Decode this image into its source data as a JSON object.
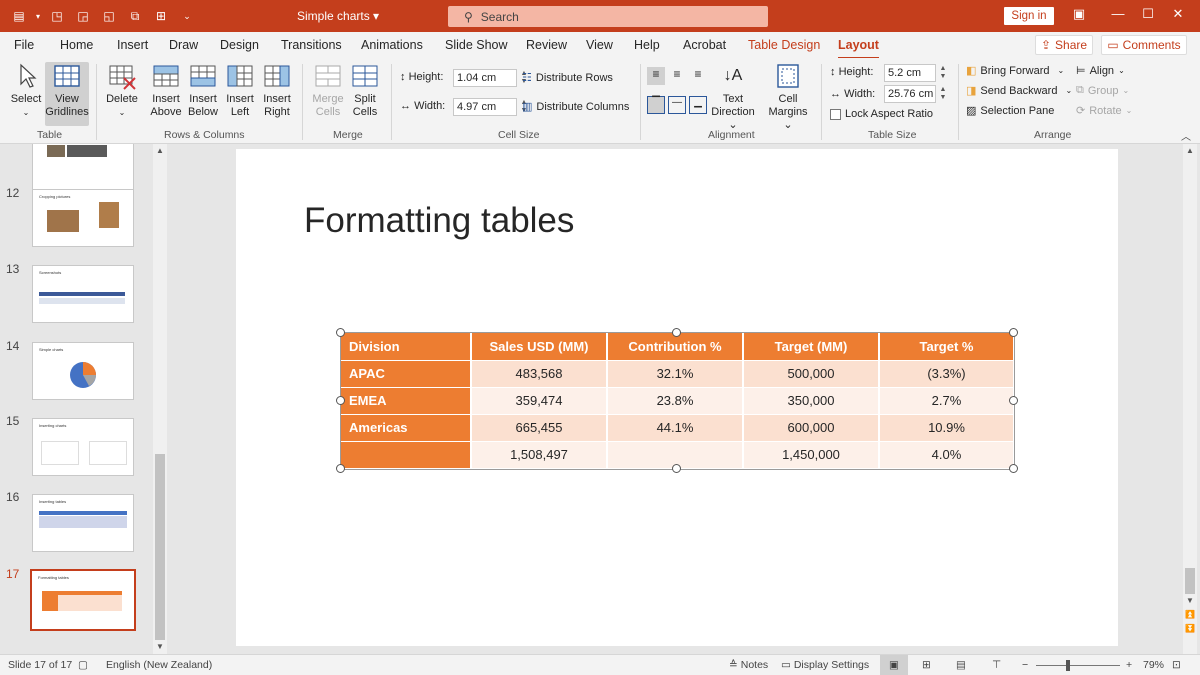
{
  "titlebar": {
    "doc_title": "Simple charts",
    "search_placeholder": "Search",
    "signin": "Sign in"
  },
  "tabs": [
    "File",
    "Home",
    "Insert",
    "Draw",
    "Design",
    "Transitions",
    "Animations",
    "Slide Show",
    "Review",
    "View",
    "Help",
    "Acrobat",
    "Table Design",
    "Layout"
  ],
  "share": "Share",
  "comments": "Comments",
  "ribbon": {
    "table_group": {
      "label": "Table",
      "select": "Select",
      "view": "View",
      "gridlines": "Gridlines"
    },
    "rows_cols_group": {
      "label": "Rows & Columns",
      "delete": "Delete",
      "insert_above_1": "Insert",
      "insert_above_2": "Above",
      "insert_below_1": "Insert",
      "insert_below_2": "Below",
      "insert_left_1": "Insert",
      "insert_left_2": "Left",
      "insert_right_1": "Insert",
      "insert_right_2": "Right"
    },
    "merge_group": {
      "label": "Merge",
      "merge_1": "Merge",
      "merge_2": "Cells",
      "split_1": "Split",
      "split_2": "Cells"
    },
    "cell_size_group": {
      "label": "Cell Size",
      "height_label": "Height:",
      "height_value": "1.04 cm",
      "width_label": "Width:",
      "width_value": "4.97 cm",
      "distribute_rows": "Distribute Rows",
      "distribute_columns": "Distribute Columns"
    },
    "alignment_group": {
      "label": "Alignment",
      "text_direction_1": "Text",
      "text_direction_2": "Direction",
      "cell_margins_1": "Cell",
      "cell_margins_2": "Margins"
    },
    "table_size_group": {
      "label": "Table Size",
      "height_label": "Height:",
      "height_value": "5.2 cm",
      "width_label": "Width:",
      "width_value": "25.76 cm",
      "lock_aspect": "Lock Aspect Ratio"
    },
    "arrange_group": {
      "label": "Arrange",
      "bring_forward": "Bring Forward",
      "send_backward": "Send Backward",
      "selection_pane": "Selection Pane",
      "align": "Align",
      "group": "Group",
      "rotate": "Rotate"
    }
  },
  "slides": [
    {
      "num": "12",
      "title": "Cropping pictures"
    },
    {
      "num": "13",
      "title": "Screenshots"
    },
    {
      "num": "14",
      "title": "Simple charts"
    },
    {
      "num": "15",
      "title": "Inserting charts"
    },
    {
      "num": "16",
      "title": "Inserting tables"
    },
    {
      "num": "17",
      "title": "Formatting tables"
    }
  ],
  "slide": {
    "title": "Formatting tables",
    "table": {
      "headers": [
        "Division",
        "Sales USD (MM)",
        "Contribution %",
        "Target (MM)",
        "Target %"
      ],
      "rows": [
        [
          "APAC",
          "483,568",
          "32.1%",
          "500,000",
          "(3.3%)"
        ],
        [
          "EMEA",
          "359,474",
          "23.8%",
          "350,000",
          "2.7%"
        ],
        [
          "Americas",
          "665,455",
          "44.1%",
          "600,000",
          "10.9%"
        ],
        [
          "",
          "1,508,497",
          "",
          "1,450,000",
          "4.0%"
        ]
      ]
    }
  },
  "statusbar": {
    "slide_info": "Slide 17 of 17",
    "language": "English (New Zealand)",
    "notes": "Notes",
    "display_settings": "Display Settings",
    "zoom": "79%"
  },
  "colors": {
    "accent": "#c43e1c",
    "table_header": "#ed7d31"
  }
}
